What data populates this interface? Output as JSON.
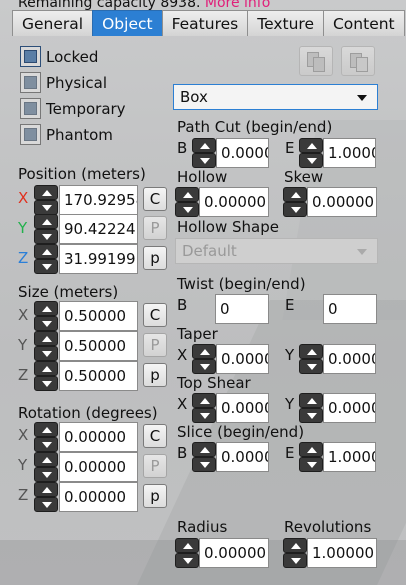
{
  "status": {
    "text": "Remaining capacity 8938.",
    "link": "More info"
  },
  "tabs": [
    "General",
    "Object",
    "Features",
    "Texture",
    "Content"
  ],
  "active_tab": "Object",
  "checkboxes": {
    "locked": "Locked",
    "physical": "Physical",
    "temporary": "Temporary",
    "phantom": "Phantom",
    "locked_checked": true
  },
  "position": {
    "label": "Position (meters)",
    "x": "170.92958",
    "y": "90.42224",
    "z": "31.99199",
    "axis_colors": {
      "x": "#e0301e",
      "y": "#22b14c",
      "z": "#2a7fd8"
    }
  },
  "size": {
    "label": "Size (meters)",
    "x": "0.50000",
    "y": "0.50000",
    "z": "0.50000"
  },
  "rotation": {
    "label": "Rotation (degrees)",
    "x": "0.00000",
    "y": "0.00000",
    "z": "0.00000"
  },
  "buttons": {
    "copy": "C",
    "paste": "P",
    "paste_lower": "p"
  },
  "axes": {
    "x": "X",
    "y": "Y",
    "z": "Z",
    "b": "B",
    "e": "E"
  },
  "shape": {
    "type": "Box",
    "path_cut": {
      "label": "Path Cut (begin/end)",
      "begin": "0.0000",
      "end": "1.0000"
    },
    "hollow": {
      "label": "Hollow",
      "value": "0.00000"
    },
    "skew": {
      "label": "Skew",
      "value": "0.00000"
    },
    "hollow_shape": {
      "label": "Hollow Shape",
      "value": "Default"
    },
    "twist": {
      "label": "Twist (begin/end)",
      "begin": "0",
      "end": "0"
    },
    "taper": {
      "label": "Taper",
      "x": "0.0000",
      "y": "0.0000"
    },
    "top_shear": {
      "label": "Top Shear",
      "x": "0.0000",
      "y": "0.0000"
    },
    "slice": {
      "label": "Slice (begin/end)",
      "begin": "0.0000",
      "end": "1.0000"
    },
    "radius": {
      "label": "Radius",
      "value": "0.00000"
    },
    "revolutions": {
      "label": "Revolutions",
      "value": "1.00000"
    }
  },
  "icons": {
    "copy_params": "copy-params-icon",
    "paste_params": "paste-params-icon"
  }
}
